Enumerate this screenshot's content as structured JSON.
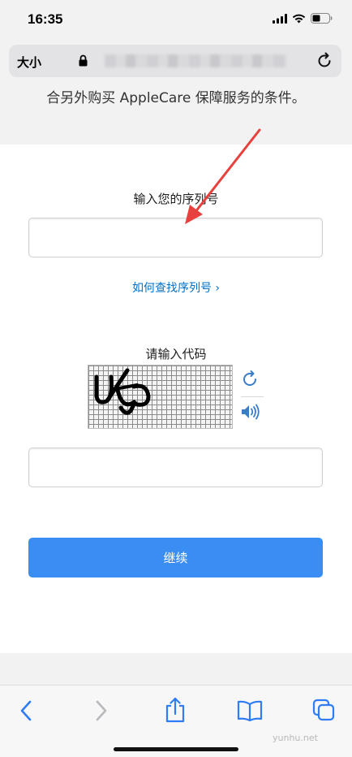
{
  "status_bar": {
    "time": "16:35"
  },
  "url_bar": {
    "text_size_label": "大小"
  },
  "page": {
    "top_text": "合另外购买 AppleCare 保障服务的条件。",
    "serial_label": "输入您的序列号",
    "serial_value": "",
    "find_serial_link": "如何查找序列号 ›",
    "code_label": "请输入代码",
    "code_value": "",
    "continue_label": "继续"
  },
  "watermark": "yunhu.net",
  "colors": {
    "accent": "#3a8ef3",
    "link": "#0070c9",
    "arrow": "#e8403c"
  }
}
